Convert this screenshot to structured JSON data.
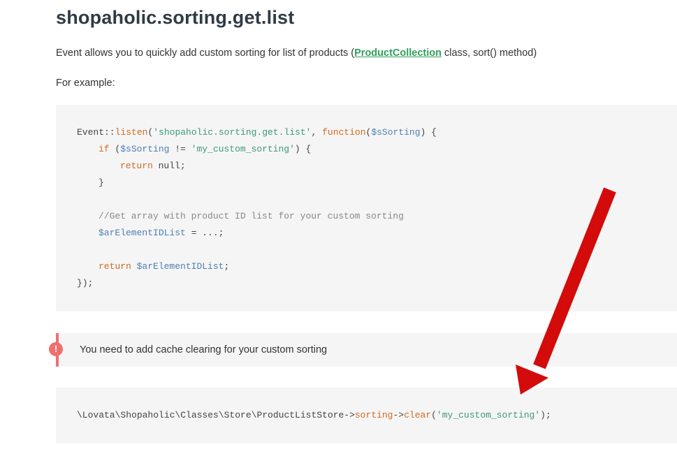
{
  "heading": "shopaholic.sorting.get.list",
  "intro": {
    "before": "Event allows you to quickly add custom sorting for list of products (",
    "link": "ProductCollection",
    "after": " class, sort() method)"
  },
  "example_label": "For example:",
  "code1": {
    "l1": {
      "a": "Event::",
      "b": "listen",
      "c": "(",
      "d": "'shopaholic.sorting.get.list'",
      "e": ", ",
      "f": "function",
      "g": "(",
      "h": "$sSorting",
      "i": ") {"
    },
    "l2": {
      "a": "if",
      "b": " (",
      "c": "$sSorting",
      "d": " != ",
      "e": "'my_custom_sorting'",
      "f": ") {"
    },
    "l3": {
      "a": "return",
      "b": " null;"
    },
    "l4": {
      "a": "}"
    },
    "l5": {
      "a": "//Get array with product ID list for your custom sorting"
    },
    "l6": {
      "a": "$arElementIDList",
      "b": " = ...;"
    },
    "l7": {
      "a": "return",
      "b": " ",
      "c": "$arElementIDList",
      "d": ";"
    },
    "l8": {
      "a": "});"
    }
  },
  "callout": {
    "icon": "!",
    "text": "You need to add cache clearing for your custom sorting",
    "accent": "#f07070"
  },
  "code2": {
    "a": "\\Lovata\\Shopaholic\\Classes\\Store\\ProductListStore->",
    "b": "sorting",
    "c": "->",
    "d": "clear",
    "e": "(",
    "f": "'my_custom_sorting'",
    "g": ");"
  },
  "colors": {
    "arrow": "#d40b0b",
    "link": "#2e9e5b"
  }
}
